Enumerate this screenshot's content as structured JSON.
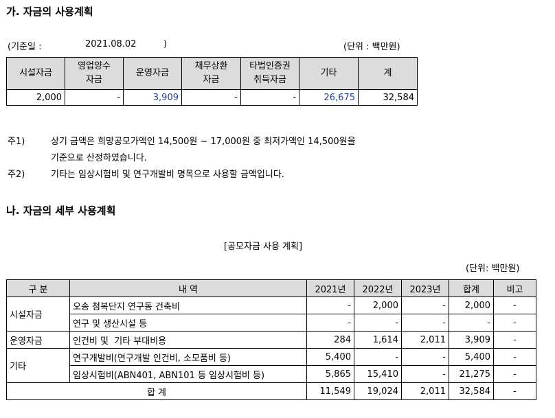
{
  "section_a": {
    "title": "가. 자금의 사용계획",
    "basis_prefix": "(기준일 :",
    "basis_date": "2021.08.02",
    "basis_suffix": ")",
    "unit": "(단위 : 백만원)",
    "headers": [
      "시설자금",
      "영업양수\n자금",
      "운영자금",
      "채무상환\n자금",
      "타법인증권\n취득자금",
      "기타",
      "계"
    ],
    "values": [
      "2,000",
      "-",
      "3,909",
      "-",
      "-",
      "26,675",
      "32,584"
    ]
  },
  "notes": [
    {
      "label": "주1)",
      "text": "상기 금액은 희망공모가액인 14,500원 ~ 17,000원 중 최저가액인 14,500원을"
    },
    {
      "label": "",
      "text": "기준으로 산정하였습니다."
    },
    {
      "label": "주2)",
      "text": "기타는 임상시험비 및 연구개발비 명목으로 사용할 금액입니다."
    }
  ],
  "section_b": {
    "title": "나. 자금의 세부 사용계획",
    "table_caption": "[공모자금 사용 계획]",
    "unit": "(단위: 백만원)",
    "headers": {
      "category": "구 분",
      "detail": "내 역",
      "y2021": "2021년",
      "y2022": "2022년",
      "y2023": "2023년",
      "total": "합계",
      "note": "비고"
    },
    "groups": {
      "facility": "시설자금",
      "operation": "운영자금",
      "other": "기타"
    },
    "rows": [
      {
        "detail": "오송 첨복단지 연구동 건축비",
        "y2021": "-",
        "y2022": "2,000",
        "y2023": "-",
        "total": "2,000",
        "note": "-"
      },
      {
        "detail": "연구 및 생산시설 등",
        "y2021": "-",
        "y2022": "-",
        "y2023": "-",
        "total": "-",
        "note": "-"
      },
      {
        "detail": "인건비 및  기타 부대비용",
        "y2021": "284",
        "y2022": "1,614",
        "y2023": "2,011",
        "total": "3,909",
        "note": "-"
      },
      {
        "detail": "연구개발비(연구개발 인건비, 소모품비 등)",
        "y2021": "5,400",
        "y2022": "-",
        "y2023": "-",
        "total": "5,400",
        "note": "-"
      },
      {
        "detail": "임상시험비(ABN401, ABN101 등 임상시험비 등)",
        "y2021": "5,865",
        "y2022": "15,410",
        "y2023": "-",
        "total": "21,275",
        "note": "-"
      }
    ],
    "sum": {
      "label": "합 계",
      "y2021": "11,549",
      "y2022": "19,024",
      "y2023": "2,011",
      "total": "32,584",
      "note": "-"
    }
  }
}
